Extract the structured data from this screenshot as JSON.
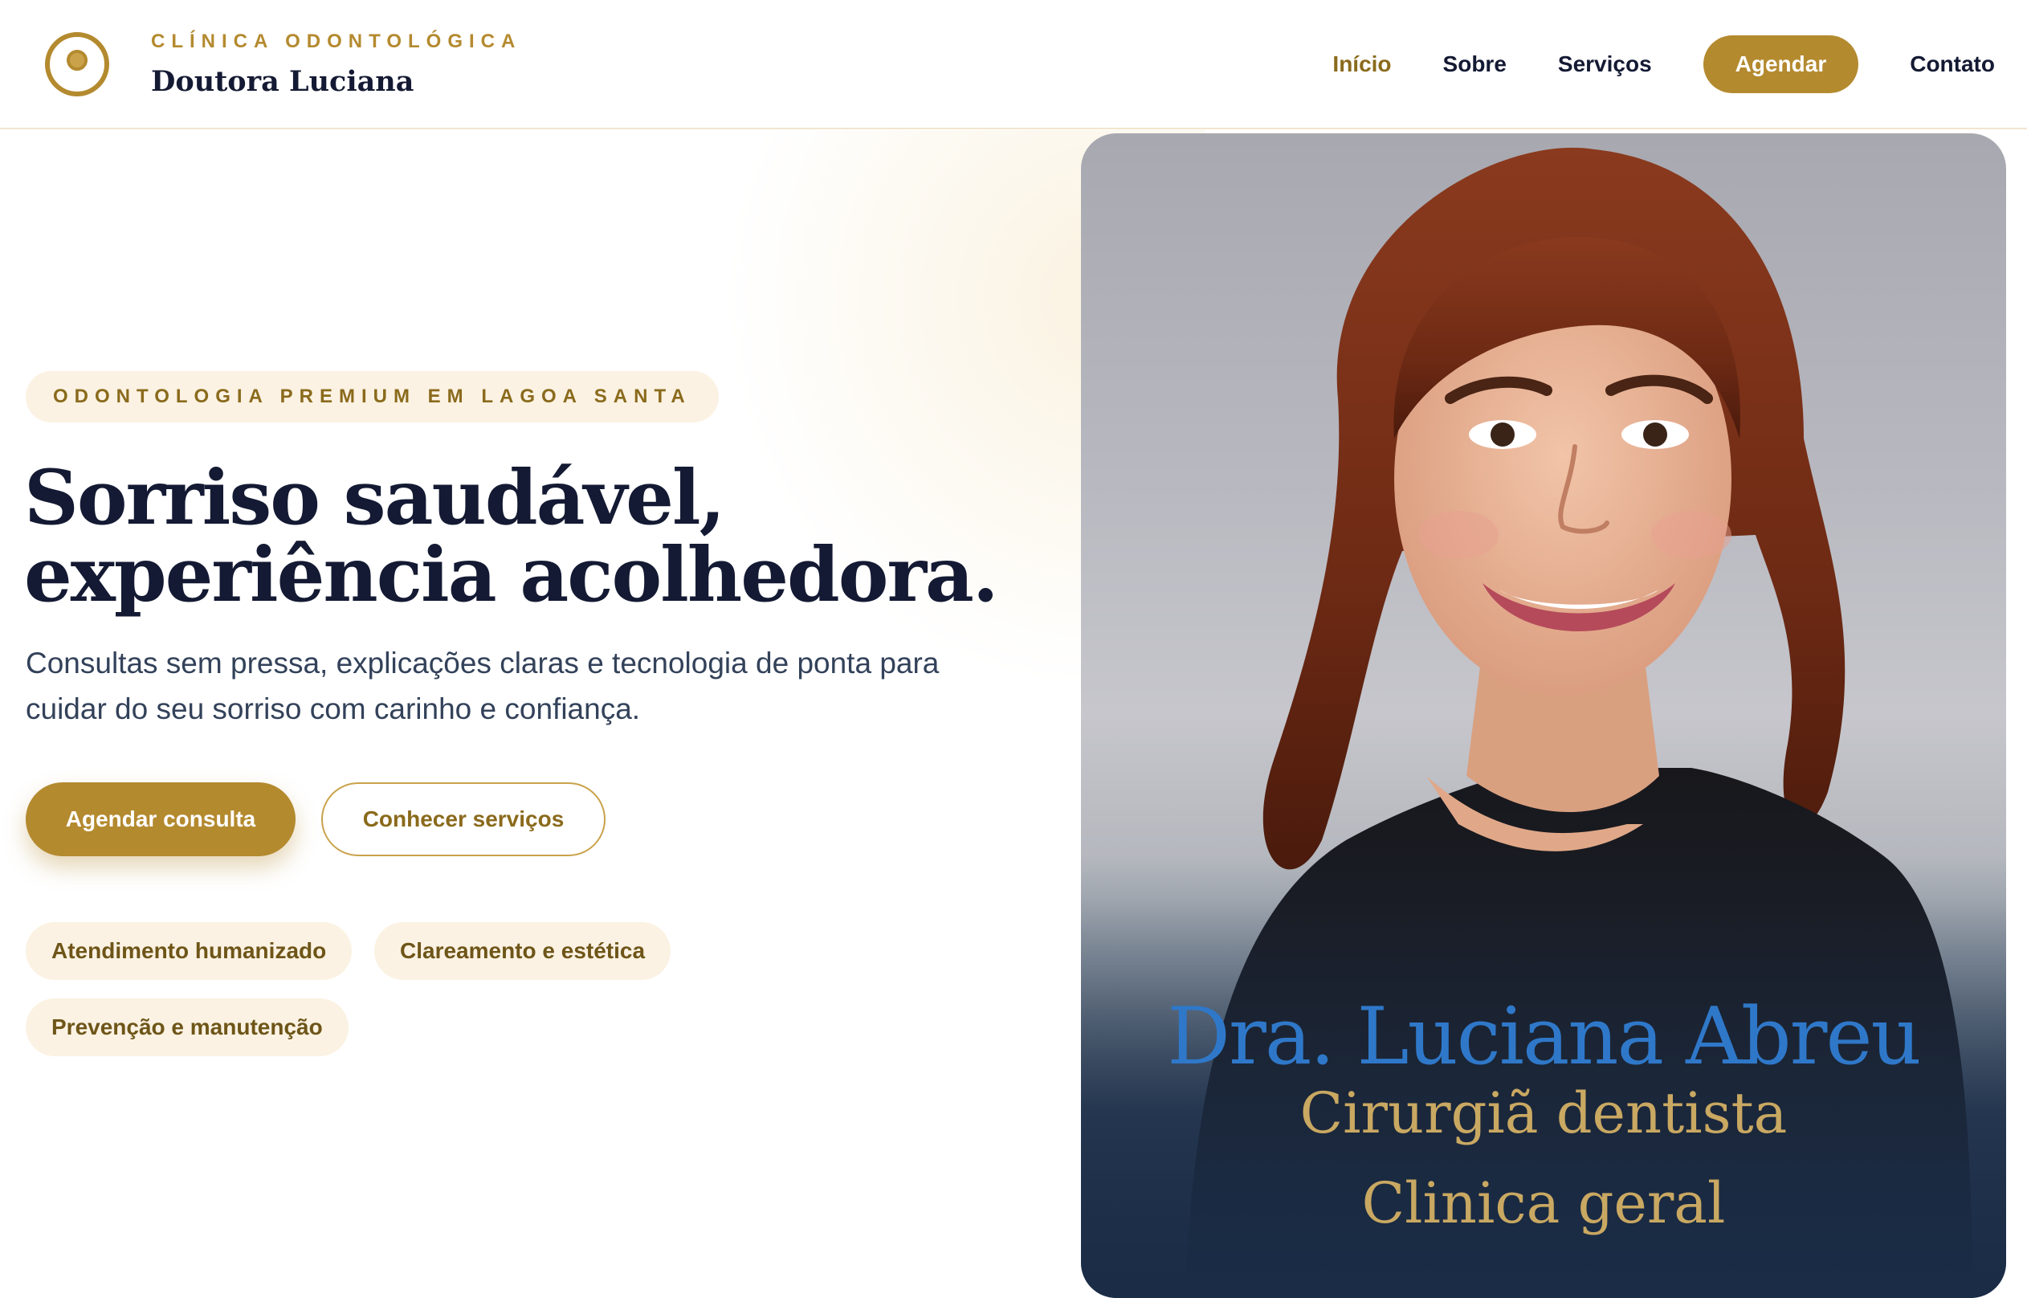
{
  "header": {
    "kicker": "CLÍNICA ODONTOLÓGICA",
    "brand_name": "Doutora Luciana",
    "logo_icon": "tooth-circle-icon",
    "nav": {
      "inicio": "Início",
      "sobre": "Sobre",
      "servicos": "Serviços",
      "agendar": "Agendar",
      "contato": "Contato"
    }
  },
  "hero": {
    "eyebrow": "ODONTOLOGIA PREMIUM EM LAGOA SANTA",
    "title_line1": "Sorriso saudável,",
    "title_line2": "experiência acolhedora.",
    "subtitle": "Consultas sem pressa, explicações claras e tecnologia de ponta para cuidar do seu sorriso com carinho e confiança.",
    "primary_cta": "Agendar consulta",
    "secondary_cta": "Conhecer serviços",
    "tags": [
      "Atendimento humanizado",
      "Clareamento e estética",
      "Prevenção e manutenção"
    ]
  },
  "portrait": {
    "name": "Dra. Luciana Abreu",
    "role_1": "Cirurgiã dentista",
    "role_2": "Clinica geral"
  },
  "colors": {
    "accent": "#b48a2f",
    "navy": "#141a33",
    "cream": "#fbf2e3",
    "name_blue": "#2f78c9"
  }
}
